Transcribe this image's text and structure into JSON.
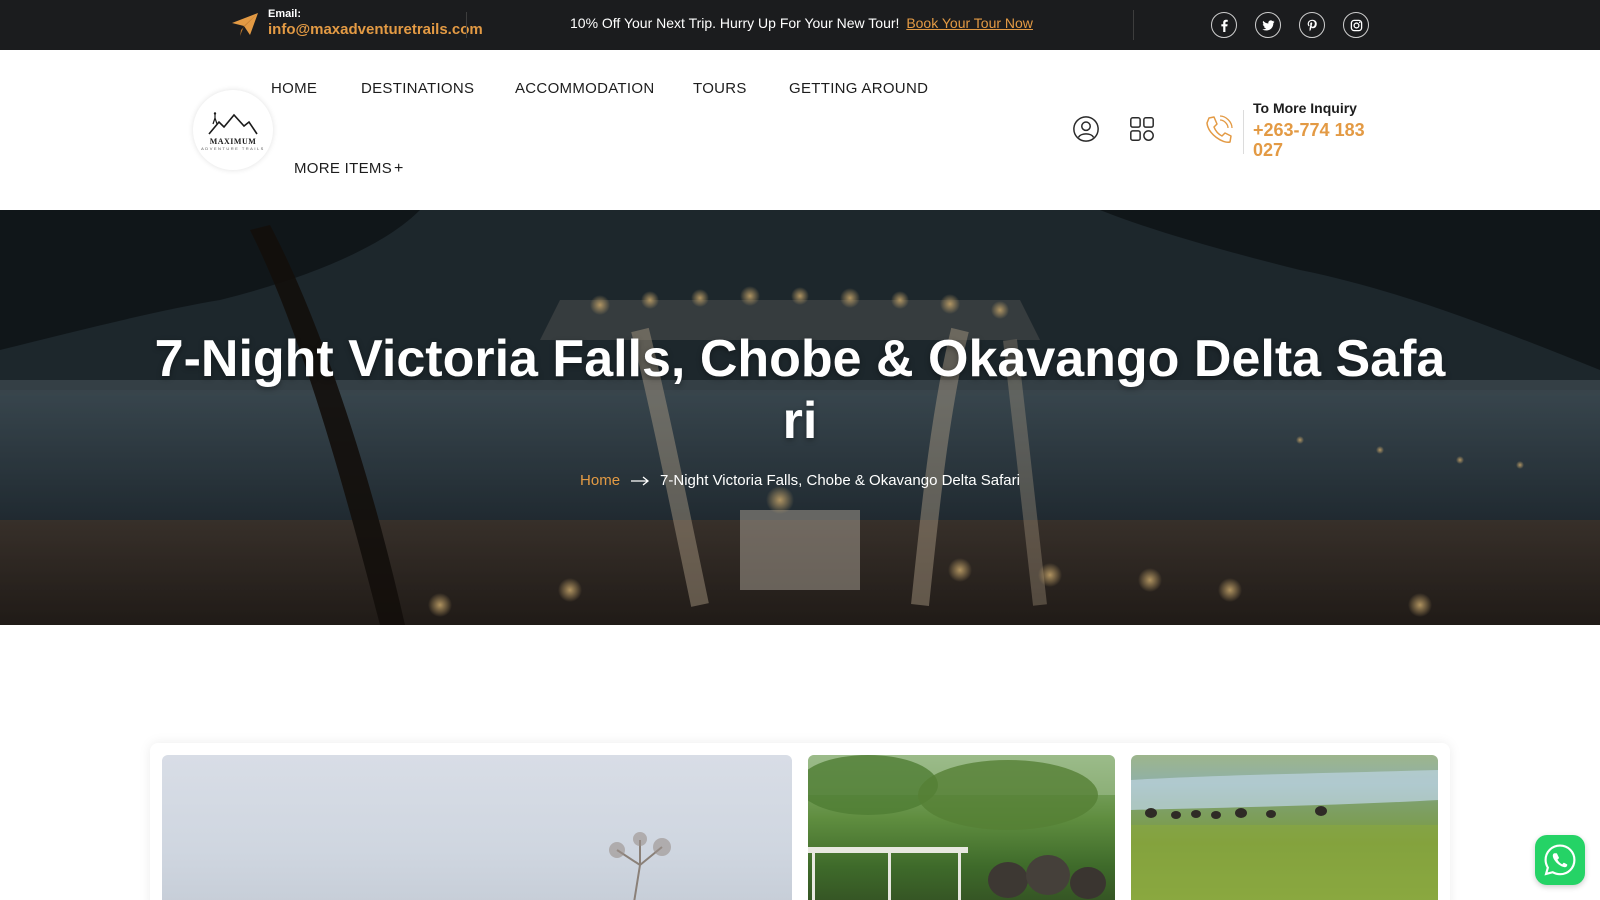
{
  "topbar": {
    "email_label": "Email:",
    "email_value": "info@maxadventuretrails.com",
    "promo_text": "10% Off Your Next Trip. Hurry Up For Your New Tour!",
    "promo_link": "Book Your Tour Now",
    "social": [
      "facebook-icon",
      "twitter-icon",
      "pinterest-icon",
      "instagram-icon"
    ],
    "accent_color": "#e39a44",
    "background_color": "#1b1c1e"
  },
  "header": {
    "logo_text": "MAXIMUM",
    "logo_subtext": "ADVENTURE TRAILS",
    "nav": {
      "home": "HOME",
      "destinations": "DESTINATIONS",
      "accommodation": "ACCOMMODATION",
      "tours": "TOURS",
      "getting_around": "GETTING AROUND",
      "more_items": "MORE ITEMS",
      "more_plus": "+"
    },
    "inquiry_label": "To More Inquiry",
    "inquiry_phone": "+263-774 183 027"
  },
  "hero": {
    "title": "7-Night Victoria Falls, Chobe & Okavango Delta Safari",
    "breadcrumb_home": "Home",
    "breadcrumb_current": "7-Night Victoria Falls, Chobe & Okavango Delta Safari"
  },
  "gallery": {
    "images": [
      "acacia-tree-photo",
      "safari-vehicle-elephants-photo",
      "elephants-river-floodplain-photo"
    ]
  },
  "whatsapp": {
    "icon": "whatsapp-icon",
    "color": "#25d366"
  }
}
